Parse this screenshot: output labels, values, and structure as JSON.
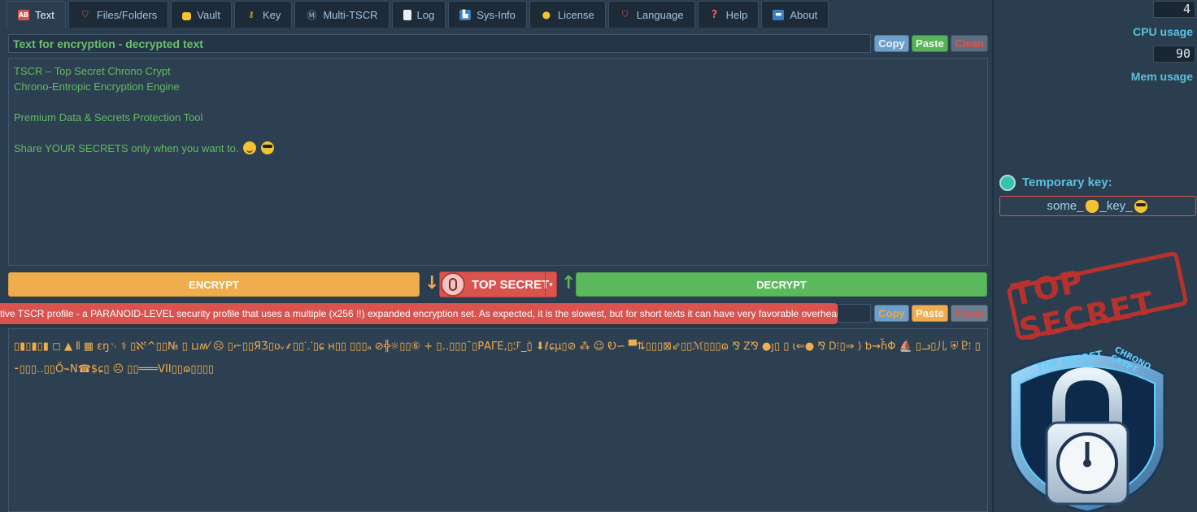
{
  "tabs": [
    {
      "label": "Text",
      "icon": "text-icon",
      "active": true
    },
    {
      "label": "Files/Folders",
      "icon": "shield-icon"
    },
    {
      "label": "Vault",
      "icon": "lock-icon"
    },
    {
      "label": "Key",
      "icon": "key-icon"
    },
    {
      "label": "Multi-TSCR",
      "icon": "multi-icon"
    },
    {
      "label": "Log",
      "icon": "log-icon"
    },
    {
      "label": "Sys-Info",
      "icon": "chart-icon"
    },
    {
      "label": "License",
      "icon": "medal-icon"
    },
    {
      "label": "Language",
      "icon": "flag-icon"
    },
    {
      "label": "Help",
      "icon": "question-icon"
    },
    {
      "label": "About",
      "icon": "info-icon"
    }
  ],
  "plain": {
    "title": "Text for encryption - decrypted text",
    "copy": "Copy",
    "paste": "Paste",
    "clean": "Clean",
    "lines": [
      "TSCR – Top Secret Chrono Crypt",
      "Chrono-Entropic Encryption Engine",
      "",
      "Premium Data & Secrets Protection Tool",
      "",
      "Share YOUR SECRETS only when you want to."
    ]
  },
  "actions": {
    "encrypt": "ENCRYPT",
    "decrypt": "DECRYPT",
    "profile": "TOP SECRET",
    "down_arrow": "↓",
    "up_arrow": "↑",
    "caret": "▾"
  },
  "tooltip": "tive TSCR profile - a PARANOID-LEVEL security profile that uses a multiple (x256 !!) expanded encryption set. As expected, it is the slowest, but for short texts it can have very favorable overhead.",
  "cipher": {
    "copy": "Copy",
    "paste": "Paste",
    "clean": "Clean",
    "text": "▯▮▯▮▯▮ ◻ ▲ ⫴ ▦ ɛŋ␋ ⚕ ▯ℵᵗ^▯▯№ ▯ ⊔ʍ⁄ ☹ ▯⌐▯▯ЯƷ▯ʋᵥ⸙▯▯⸪▯ɕ  ʜ▯▯  ▯▯▯ₐ ⊘╬☼▯▯⑥ + ▯‥▯▯▯¯▯ΡΑΓE,▯ℱ_▯̣̇ ⬇ℓɕµ▯⊘ ⁂ ☺ Ꭷ∽ ▀⇅▯▯▯⊠⇙▯▯ℳ▯▯▯ɷ ⅋ Ꮓ⅋ ●ȷ▯ ▯ ɩ⇐● ⅋ Ꭰ⁝▯⇒ ⟩ ƅ⇝ɦ̌Φ ⛵ ▯ᓗ▯儿 ⛨ Ⴒ⁝ ▯⁃▯▯▯‥▯▯Ő⌁N☎$ɕ▯ ☹ ▯▯═══VII▯▯ɷ▯▯▯▯"
  },
  "system": {
    "cpu_value": "4",
    "cpu_label": "CPU usage",
    "mem_value": "90",
    "mem_label": "Mem usage"
  },
  "temp_key": {
    "label": "Temporary key:",
    "value_prefix": "some_",
    "value_mid": "_key_"
  },
  "stamp_text": "TOP SECRET",
  "logo": {
    "top_text": "TOP SECRET",
    "side_text": "CHRONO CRYPT"
  },
  "colors": {
    "bg": "#2b3e50",
    "accent_blue": "#5bc0de",
    "green": "#5cb85c",
    "orange": "#f0ad4e",
    "red": "#d9534f"
  }
}
